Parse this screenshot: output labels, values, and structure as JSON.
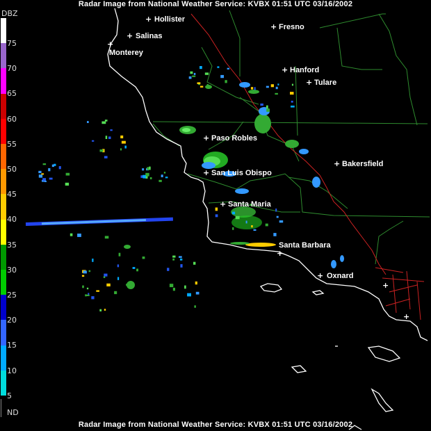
{
  "header": {
    "title": "Radar Image from National Weather Service: KVBX   01:51 UTC  03/16/2002"
  },
  "footer": {
    "title": "Radar Image from National Weather Service: KVBX   01:51 UTC  03/16/2002"
  },
  "legend": {
    "unit": "DBZ",
    "no_data": "ND",
    "bands": [
      {
        "label": "75",
        "color": "#ffffff"
      },
      {
        "label": "70",
        "color": "#9966cc"
      },
      {
        "label": "65",
        "color": "#ff00ff"
      },
      {
        "label": "60",
        "color": "#cc0000"
      },
      {
        "label": "55",
        "color": "#ff0000"
      },
      {
        "label": "50",
        "color": "#ff6600"
      },
      {
        "label": "45",
        "color": "#ff9900"
      },
      {
        "label": "40",
        "color": "#ffcc00"
      },
      {
        "label": "35",
        "color": "#ffff00"
      },
      {
        "label": "30",
        "color": "#009900"
      },
      {
        "label": "25",
        "color": "#00cc00"
      },
      {
        "label": "20",
        "color": "#0000cc"
      },
      {
        "label": "15",
        "color": "#3366ff"
      },
      {
        "label": "10",
        "color": "#00aaff"
      },
      {
        "label": "5",
        "color": "#00dddd"
      }
    ]
  },
  "cities": [
    {
      "name": "Hollister"
    },
    {
      "name": "Salinas"
    },
    {
      "name": "Monterey"
    },
    {
      "name": "Fresno"
    },
    {
      "name": "Hanford"
    },
    {
      "name": "Tulare"
    },
    {
      "name": "Paso Robles"
    },
    {
      "name": "San Luis Obispo"
    },
    {
      "name": "Bakersfield"
    },
    {
      "name": "Santa Maria"
    },
    {
      "name": "Santa Barbara"
    },
    {
      "name": "Oxnard"
    }
  ],
  "colors": {
    "background": "#000000",
    "coastline": "#ffffff",
    "county_lines": "#2e8b2e",
    "highway": "#cc2222"
  }
}
